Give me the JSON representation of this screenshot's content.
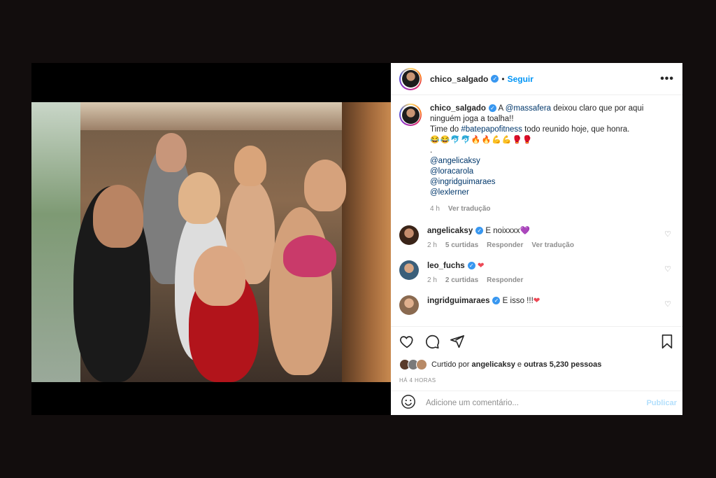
{
  "post": {
    "author": "chico_salgado",
    "follow_label": "Seguir",
    "dot": "•",
    "more_label": "•••"
  },
  "caption": {
    "author": "chico_salgado",
    "text_a": "A ",
    "mention1": "@massafera",
    "text_b": " deixou claro que por aqui ninguém joga a toalha!!",
    "text_c": "Time do ",
    "hashtag": "#batepapofitness",
    "text_d": " todo reunido hoje, que honra.",
    "emojis": "😂😂🐬🐬🔥🔥💪💪🥊🥊",
    "dot_line": ".",
    "mentions": [
      "@angelicaksy",
      "@loracarola",
      "@ingridguimaraes",
      "@lexlerner"
    ],
    "time": "4 h",
    "translate": "Ver tradução"
  },
  "comments": [
    {
      "user": "angelicaksy",
      "text": "E noixxxx",
      "heart": "💜",
      "time": "2 h",
      "likes": "5 curtidas",
      "reply": "Responder",
      "translate": "Ver tradução"
    },
    {
      "user": "leo_fuchs",
      "text": "",
      "heart": "❤",
      "time": "2 h",
      "likes": "2 curtidas",
      "reply": "Responder"
    },
    {
      "user": "ingridguimaraes",
      "text": "E isso !!!",
      "heart": "❤"
    }
  ],
  "likes": {
    "prefix": "Curtido por ",
    "user": "angelicaksy",
    "middle": " e ",
    "others": "outras 5,230 pessoas"
  },
  "timestamp": "HÁ 4 HORAS",
  "add_comment": {
    "placeholder": "Adicione um comentário...",
    "publish_label": "Publicar"
  },
  "colors": {
    "accent": "#0095f6",
    "link": "#00376b",
    "heart_red": "#ed4956",
    "background": "#120d0d"
  }
}
